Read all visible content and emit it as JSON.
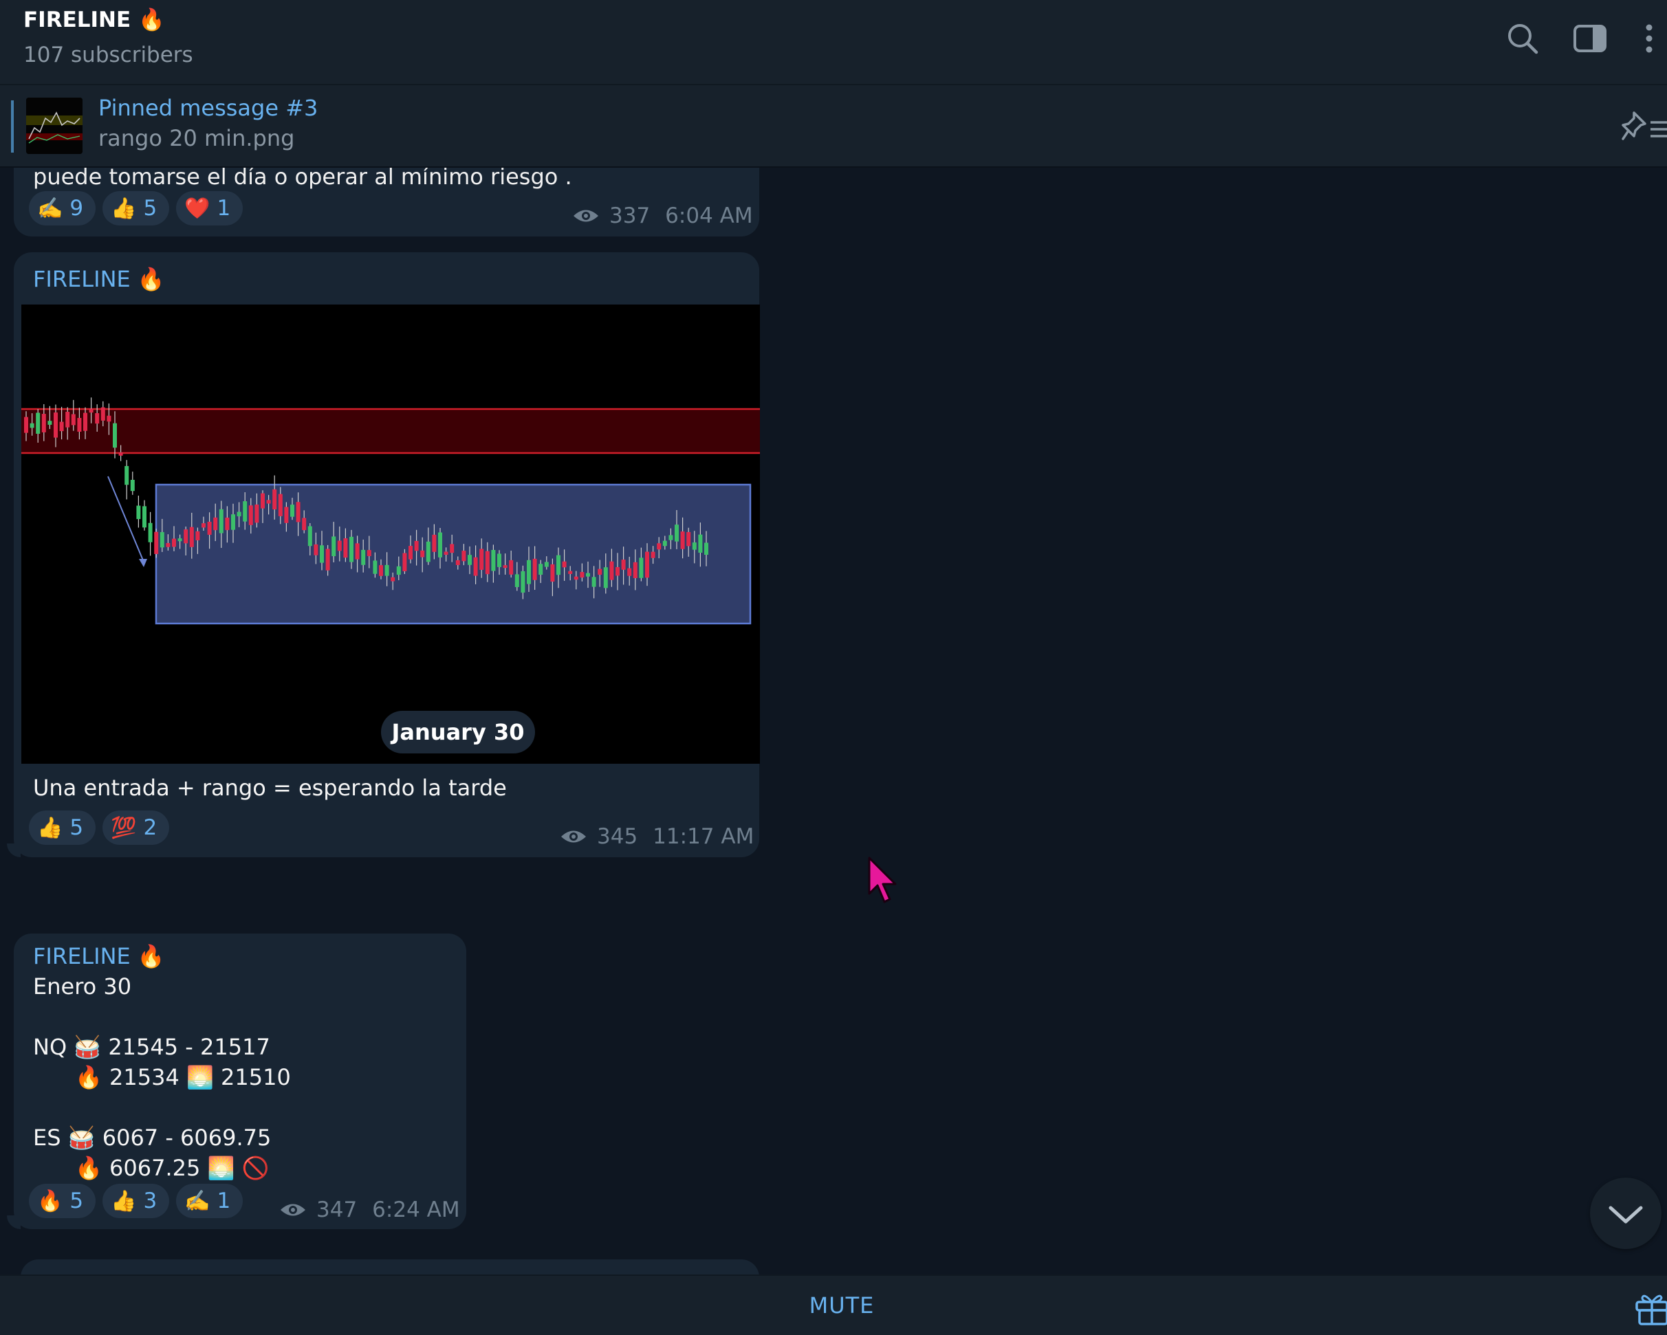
{
  "header": {
    "title": "FIRELINE 🔥",
    "subtitle": "107 subscribers",
    "icons": [
      "search-icon",
      "sidebar-toggle-icon",
      "more-vertical-icon"
    ]
  },
  "pinned": {
    "title": "Pinned message #3",
    "subtitle": "rango 20 min.png",
    "icon": "pin-list-icon"
  },
  "messages": [
    {
      "partial_text": "puede tomarse el día o operar al mínimo riesgo .",
      "reactions": [
        {
          "emoji": "✍️",
          "count": "9"
        },
        {
          "emoji": "👍",
          "count": "5"
        },
        {
          "emoji": "❤️",
          "count": "1"
        }
      ],
      "views": "337",
      "time": "6:04 AM"
    },
    {
      "sender": "FIRELINE 🔥",
      "caption": "Una entrada + rango = esperando la tarde",
      "reactions": [
        {
          "emoji": "👍",
          "count": "5"
        },
        {
          "emoji": "💯",
          "count": "2"
        }
      ],
      "views": "345",
      "time": "11:17 AM"
    },
    {
      "sender": "FIRELINE 🔥",
      "lines": [
        "Enero 30",
        "",
        "NQ 🥁 21545 - 21517",
        "      🔥 21534 🌅 21510",
        "",
        "ES 🥁 6067 - 6069.75",
        "      🔥 6067.25 🌅 🚫"
      ],
      "reactions": [
        {
          "emoji": "🔥",
          "count": "5"
        },
        {
          "emoji": "👍",
          "count": "3"
        },
        {
          "emoji": "✍️",
          "count": "1"
        }
      ],
      "views": "347",
      "time": "6:24 AM"
    }
  ],
  "date_separator": "January 30",
  "bottom": {
    "mute_label": "MUTE",
    "gift_icon": "gift-icon"
  },
  "colors": {
    "background": "#0e1621",
    "bar": "#17212b",
    "bubble": "#182533",
    "accent": "#69b2ef",
    "muted": "#6f7f8e"
  }
}
